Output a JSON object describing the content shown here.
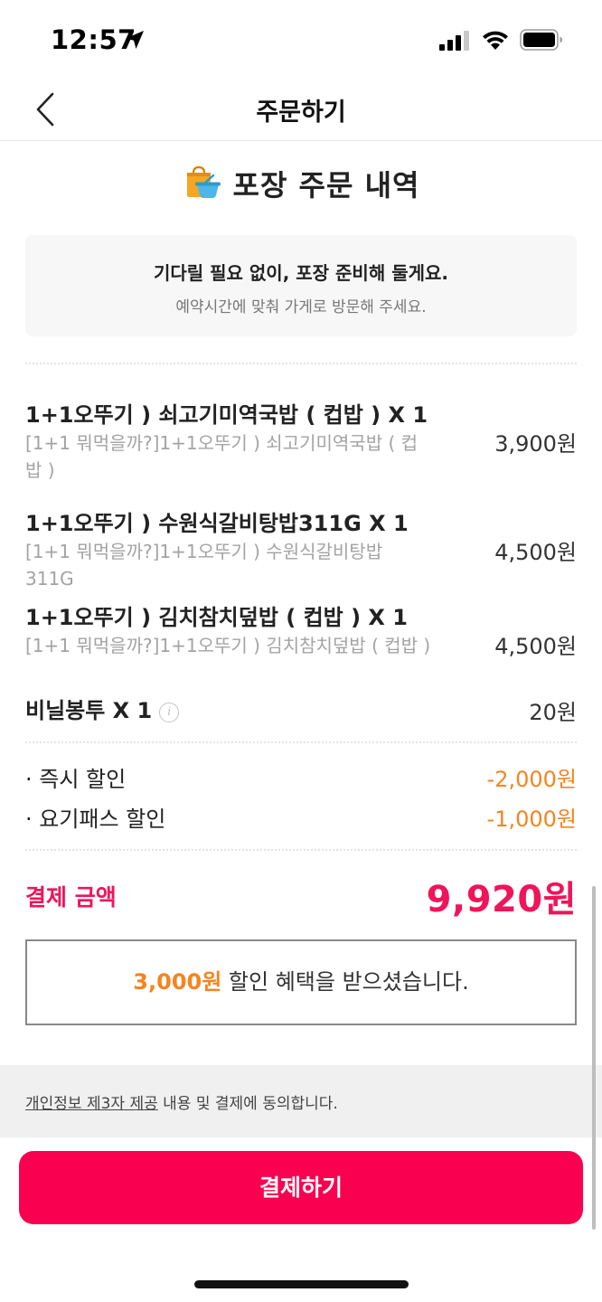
{
  "status": {
    "time": "12:57"
  },
  "nav": {
    "title": "주문하기"
  },
  "section": {
    "title": "포장 주문 내역",
    "icon": "shopping-bag-icon"
  },
  "info": {
    "main": "기다릴 필요 없이, 포장 준비해 둘게요.",
    "sub": "예약시간에 맞춰 가게로 방문해 주세요."
  },
  "items": [
    {
      "name": "1+1오뚜기 ) 쇠고기미역국밥 ( 컵밥 )  X 1",
      "desc": "[1+1 뭐먹을까?]1+1오뚜기 ) 쇠고기미역국밥 ( 컵밥 )",
      "price": "3,900원"
    },
    {
      "name": "1+1오뚜기 ) 수원식갈비탕밥311G X 1",
      "desc": "[1+1 뭐먹을까?]1+1오뚜기 ) 수원식갈비탕밥 311G",
      "price": "4,500원"
    },
    {
      "name": "1+1오뚜기 ) 김치참치덮밥 ( 컵밥 )  X 1",
      "desc": "[1+1 뭐먹을까?]1+1오뚜기 ) 김치참치덮밥 ( 컵밥 )",
      "price": "4,500원"
    }
  ],
  "bag": {
    "name": "비닐봉투 X 1",
    "info_icon": "i",
    "price": "20원"
  },
  "discounts": [
    {
      "label": "· 즉시 할인",
      "value": "-2,000원"
    },
    {
      "label": "· 요기패스 할인",
      "value": "-1,000원"
    }
  ],
  "total": {
    "label": "결제 금액",
    "value": "9,920원"
  },
  "benefit": {
    "amount": "3,000원",
    "text": " 할인 혜택을 받으셨습니다."
  },
  "agreement": {
    "link": "개인정보 제3자 제공",
    "text": " 내용 및 결제에 동의합니다."
  },
  "pay_button": {
    "label": "결제하기"
  },
  "colors": {
    "brand": "#fa0050",
    "total": "#f0145a",
    "discount": "#f5841f"
  }
}
